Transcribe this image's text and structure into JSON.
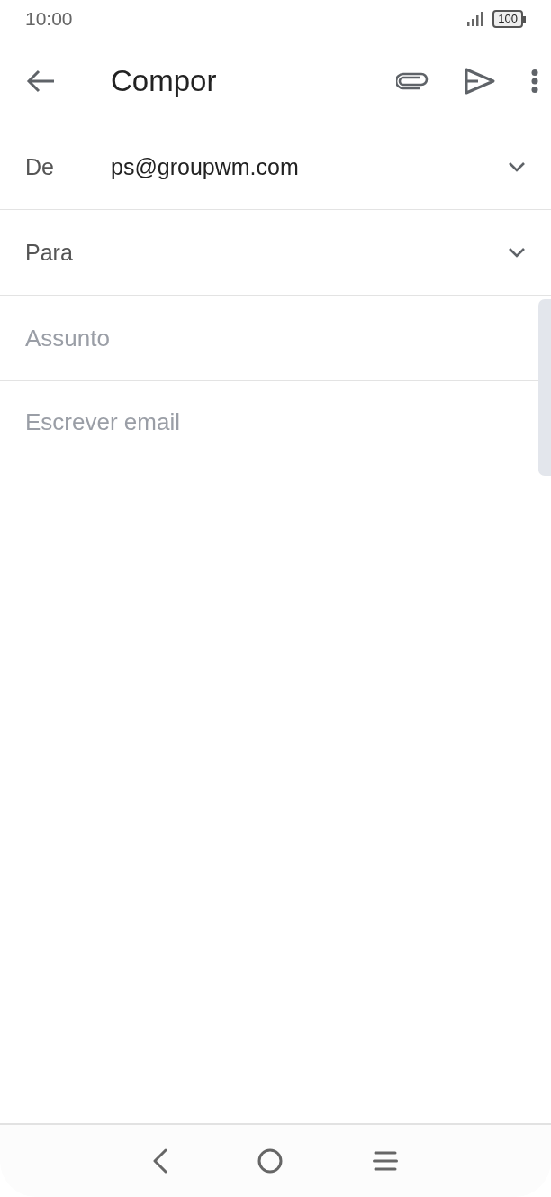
{
  "status_bar": {
    "time": "10:00",
    "battery": "100"
  },
  "app_bar": {
    "title": "Compor"
  },
  "fields": [
    {
      "kind": "select",
      "label": "De",
      "value": "ps@groupwm.com"
    },
    {
      "kind": "select",
      "label": "Para"
    },
    {
      "kind": "input",
      "placeholder": "Assunto"
    }
  ],
  "body": {
    "placeholder": "Escrever email"
  }
}
